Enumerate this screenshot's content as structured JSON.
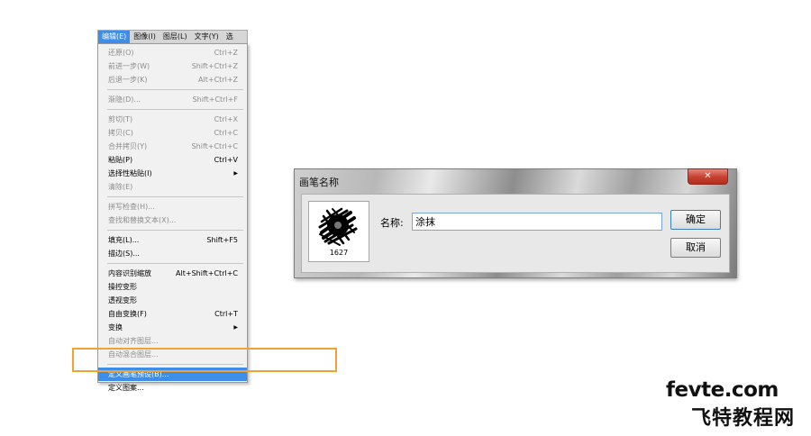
{
  "menubar": {
    "items": [
      "编辑(E)",
      "图像(I)",
      "图层(L)",
      "文字(Y)",
      "选"
    ]
  },
  "menu": {
    "items": [
      {
        "label": "还原(O)",
        "shortcut": "Ctrl+Z"
      },
      {
        "label": "前进一步(W)",
        "shortcut": "Shift+Ctrl+Z"
      },
      {
        "label": "后退一步(K)",
        "shortcut": "Alt+Ctrl+Z"
      },
      {
        "label": "渐隐(D)...",
        "shortcut": "Shift+Ctrl+F"
      },
      {
        "label": "剪切(T)",
        "shortcut": "Ctrl+X"
      },
      {
        "label": "拷贝(C)",
        "shortcut": "Ctrl+C"
      },
      {
        "label": "合并拷贝(Y)",
        "shortcut": "Shift+Ctrl+C"
      },
      {
        "label": "粘贴(P)",
        "shortcut": "Ctrl+V"
      },
      {
        "label": "选择性粘贴(I)",
        "shortcut": ""
      },
      {
        "label": "清除(E)",
        "shortcut": ""
      },
      {
        "label": "拼写检查(H)...",
        "shortcut": ""
      },
      {
        "label": "查找和替换文本(X)...",
        "shortcut": ""
      },
      {
        "label": "填充(L)...",
        "shortcut": "Shift+F5"
      },
      {
        "label": "描边(S)...",
        "shortcut": ""
      },
      {
        "label": "内容识别缩放",
        "shortcut": "Alt+Shift+Ctrl+C"
      },
      {
        "label": "操控变形",
        "shortcut": ""
      },
      {
        "label": "透视变形",
        "shortcut": ""
      },
      {
        "label": "自由变换(F)",
        "shortcut": "Ctrl+T"
      },
      {
        "label": "变换",
        "shortcut": ""
      },
      {
        "label": "自动对齐图层...",
        "shortcut": ""
      },
      {
        "label": "自动混合图层...",
        "shortcut": ""
      },
      {
        "label": "定义画笔预设(B)...",
        "shortcut": ""
      },
      {
        "label": "定义图案...",
        "shortcut": ""
      }
    ]
  },
  "dialog": {
    "title": "画笔名称",
    "close_symbol": "✕",
    "brush_size": "1627",
    "name_label": "名称:",
    "name_value": "涂抹",
    "ok_label": "确定",
    "cancel_label": "取消"
  },
  "watermark": {
    "line1": "fevte.com",
    "line2": "飞特教程网"
  },
  "colors": {
    "highlight": "#3d8ee8",
    "annotation_box": "#f0a233"
  }
}
